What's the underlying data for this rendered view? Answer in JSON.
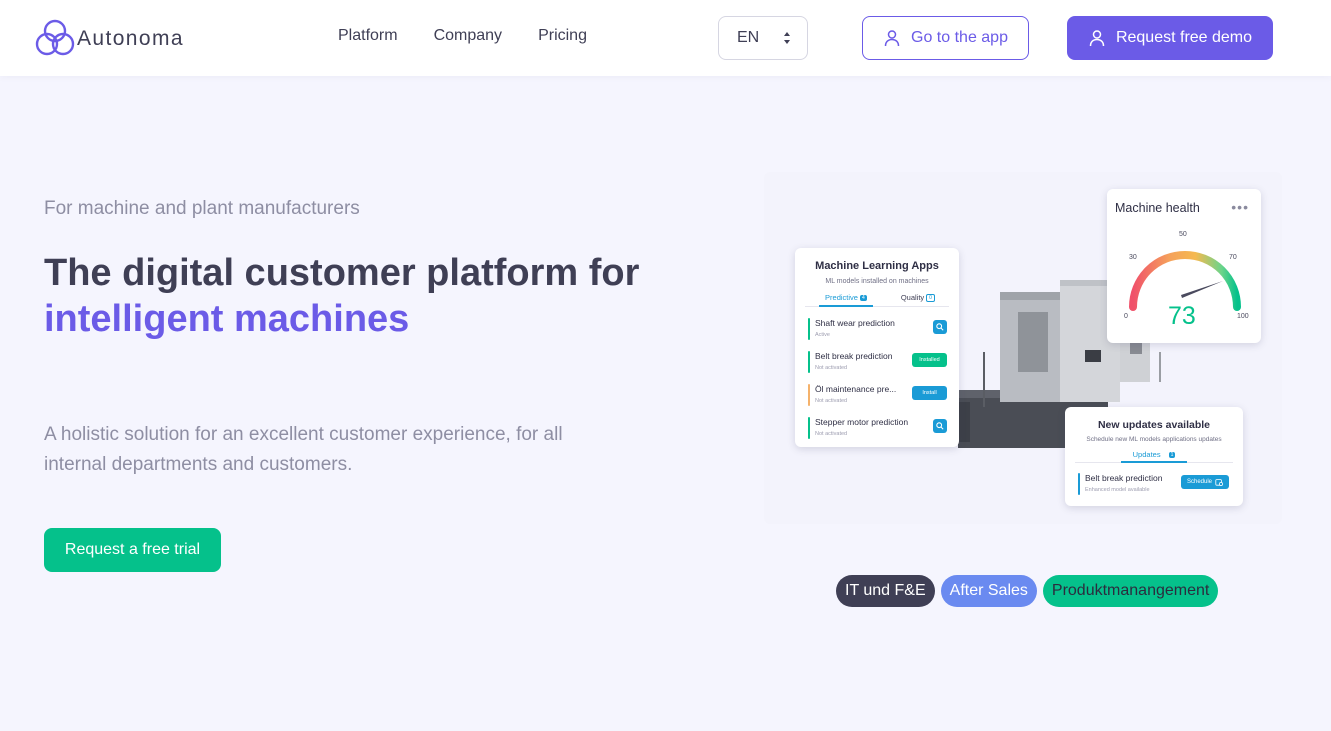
{
  "header": {
    "brand": "Autonoma",
    "nav": [
      "Platform",
      "Company",
      "Pricing"
    ],
    "language": "EN",
    "app_button": "Go to the app",
    "demo_button": "Request free demo"
  },
  "hero": {
    "eyebrow": "For machine and plant manufacturers",
    "headline_line1": "The digital customer platform for",
    "headline_accent": "intelligent machines",
    "description": "A holistic solution for an excellent customer experience, for all internal departments and customers.",
    "cta": "Request a free trial"
  },
  "ml_card": {
    "title": "Machine Learning Apps",
    "subtitle": "ML models installed on machines",
    "tab_predictive": "Predictive",
    "tab_predictive_count": "4",
    "tab_quality": "Quality",
    "tab_quality_count": "0",
    "rows": [
      {
        "name": "Shaft wear prediction",
        "status": "Active",
        "color": "#05c18b",
        "action": ""
      },
      {
        "name": "Belt break prediction",
        "status": "Not activated",
        "color": "#05c18b",
        "action": "Installed"
      },
      {
        "name": "Öl maintenance pre...",
        "status": "Not activated",
        "color": "#f5b26b",
        "action": "Install"
      },
      {
        "name": "Stepper motor prediction",
        "status": "Not activated",
        "color": "#05c18b",
        "action": ""
      }
    ]
  },
  "health_card": {
    "title": "Machine health",
    "value": 73,
    "ticks": [
      "0",
      "30",
      "50",
      "70",
      "100"
    ]
  },
  "updates_card": {
    "title": "New updates available",
    "subtitle": "Schedule new ML models applications updates",
    "tab": "Updates",
    "tab_count": "1",
    "row_name": "Belt break prediction",
    "row_status": "Enhanced model available",
    "row_action": "Schedule"
  },
  "tags": [
    "IT und F&E",
    "After Sales",
    "Produktmanangement"
  ],
  "colors": {
    "accent": "#6b5be7",
    "green": "#05c18b",
    "blue": "#1a9bd6",
    "dark": "#3f3f55"
  }
}
